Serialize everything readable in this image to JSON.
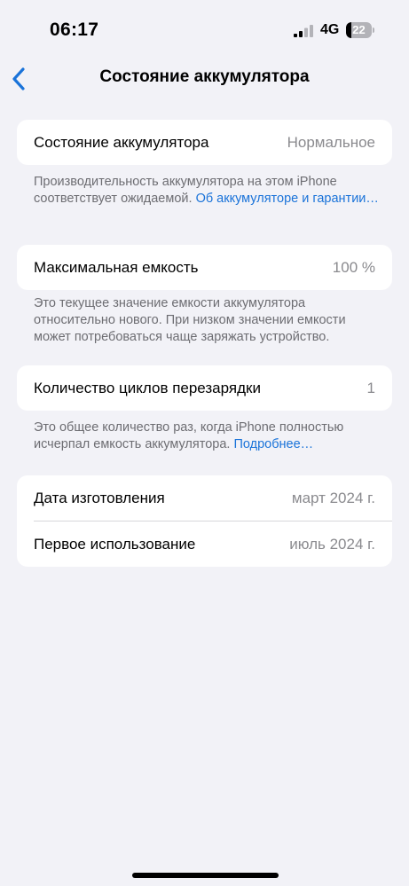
{
  "status_bar": {
    "time": "06:17",
    "network": "4G",
    "battery_level": "22",
    "battery_fraction": 0.22
  },
  "nav": {
    "title": "Состояние аккумулятора",
    "back_icon": "chevron-left-icon"
  },
  "sections": {
    "health": {
      "label": "Состояние аккумулятора",
      "value": "Нормальное",
      "footnote_text": "Производительность аккумулятора на этом iPhone соответствует ожидаемой. ",
      "footnote_link": "Об аккумуляторе и гарантии…"
    },
    "capacity": {
      "label": "Максимальная емкость",
      "value": "100 %",
      "footnote_text": "Это текущее значение емкости аккумулятора относительно нового. При низком значении емкости может потребоваться чаще заряжать устройство."
    },
    "cycles": {
      "label": "Количество циклов перезарядки",
      "value": "1",
      "footnote_text": "Это общее количество раз, когда iPhone полностью исчерпал емкость аккумулятора. ",
      "footnote_link": "Подробнее…"
    },
    "dates": {
      "manufacture_label": "Дата изготовления",
      "manufacture_value": "март 2024 г.",
      "first_use_label": "Первое использование",
      "first_use_value": "июль 2024 г."
    }
  },
  "colors": {
    "background": "#f2f2f7",
    "card": "#ffffff",
    "accent": "#1a73d9",
    "secondary_text": "#8a8a8e",
    "footnote_text": "#6d6d72"
  }
}
